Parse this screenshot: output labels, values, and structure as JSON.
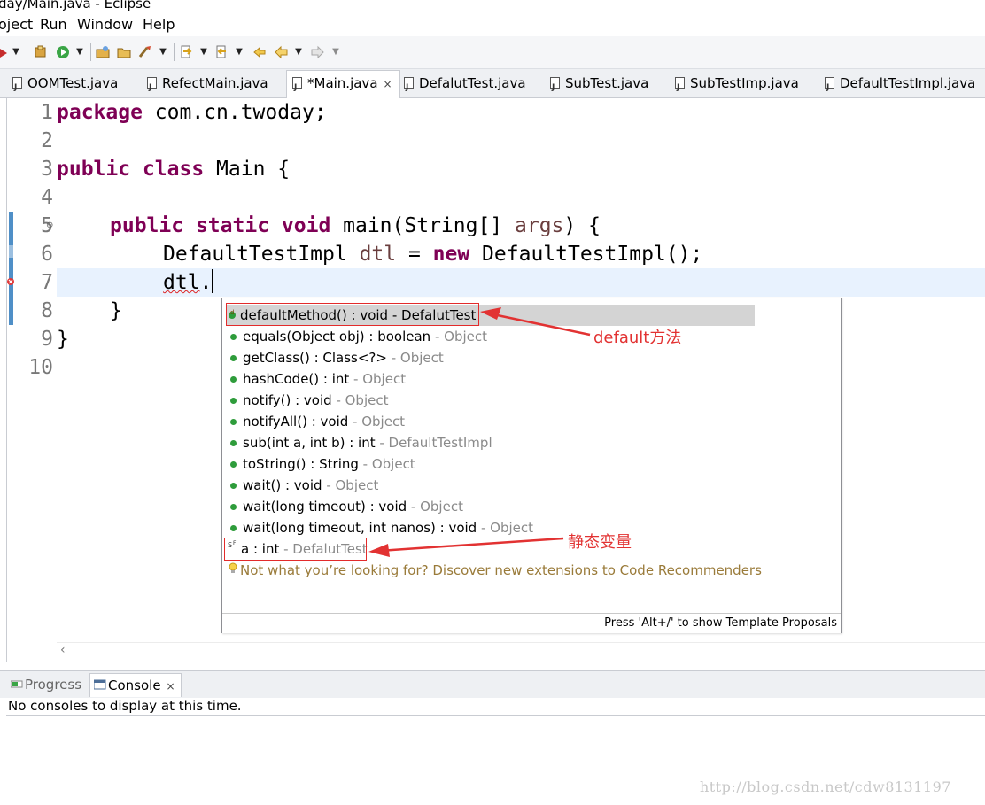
{
  "window": {
    "title": "day/Main.java - Eclipse"
  },
  "menu": [
    {
      "label": "oject"
    },
    {
      "label": "Run"
    },
    {
      "label": "Window"
    },
    {
      "label": "Help"
    }
  ],
  "tabs": [
    {
      "label": "OOMTest.java"
    },
    {
      "label": "RefectMain.java"
    },
    {
      "label": "*Main.java",
      "close": "×"
    },
    {
      "label": "DefalutTest.java"
    },
    {
      "label": "SubTest.java"
    },
    {
      "label": "SubTestImp.java"
    },
    {
      "label": "DefaultTestImpl.java"
    }
  ],
  "editor": {
    "line_numbers": [
      "1",
      "2",
      "3",
      "4",
      "5",
      "6",
      "7",
      "8",
      "9",
      "10"
    ],
    "code": {
      "l1_kw": "package",
      "l1_rest": " com.cn.twoday;",
      "l3_kw1": "public",
      "l3_kw2": "class",
      "l3_rest": " Main {",
      "l5_kw1": "public",
      "l5_kw2": "static",
      "l5_kw3": "void",
      "l5_mid": " main(String[] ",
      "l5_param": "args",
      "l5_end": ") {",
      "l6_a": "DefaultTestImpl ",
      "l6_var": "dtl",
      "l6_b": " = ",
      "l6_kw": "new",
      "l6_c": " DefaultTestImpl();",
      "l7_var": "dtl",
      "l7_dot": ".",
      "l8": "}",
      "l9": "}"
    }
  },
  "autocomplete": {
    "items": [
      {
        "sig": "defaultMethod() : void",
        "decl": " - DefalutTest"
      },
      {
        "sig": "equals(Object obj) : boolean",
        "decl": " - Object"
      },
      {
        "sig": "getClass() : Class<?>",
        "decl": " - Object"
      },
      {
        "sig": "hashCode() : int",
        "decl": " - Object"
      },
      {
        "sig": "notify() : void",
        "decl": " - Object"
      },
      {
        "sig": "notifyAll() : void",
        "decl": " - Object"
      },
      {
        "sig": "sub(int a, int b) : int",
        "decl": " - DefaultTestImpl"
      },
      {
        "sig": "toString() : String",
        "decl": " - Object"
      },
      {
        "sig": "wait() : void",
        "decl": " - Object"
      },
      {
        "sig": "wait(long timeout) : void",
        "decl": " - Object"
      },
      {
        "sig": "wait(long timeout, int nanos) : void",
        "decl": " - Object"
      },
      {
        "sig": "a : int",
        "decl": " - DefalutTest"
      }
    ],
    "hint": "Not what you’re looking for? Discover new extensions to Code Recommenders",
    "footer": "Press 'Alt+/' to show Template Proposals"
  },
  "annotations": {
    "default_method": "default方法",
    "static_var": "静态变量"
  },
  "console": {
    "tabs": [
      {
        "label": "Progress"
      },
      {
        "label": "Console",
        "close": "×"
      }
    ],
    "message": "No consoles to display at this time."
  },
  "watermark": "http://blog.csdn.net/cdw8131197",
  "colors": {
    "keyword": "#7f0055",
    "parameter": "#6a3e3e",
    "current_line": "#e8f2fe",
    "annotation_red": "#e23232",
    "method_dot": "#2e9c3b"
  }
}
